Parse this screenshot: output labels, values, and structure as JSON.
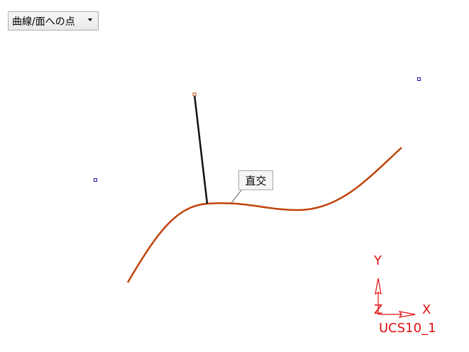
{
  "toolbar": {
    "mode_select": {
      "selected": "曲線/面への点"
    }
  },
  "annotation": {
    "constraint_label": "直交"
  },
  "ucs": {
    "x_label": "X",
    "y_label": "Y",
    "z_label": "Z",
    "name": "UCS10_1"
  },
  "colors": {
    "curve": "#c0440a",
    "line": "#111111",
    "control_point": "#1a1aa0",
    "endpoint_marker": "#c05010",
    "ucs": "#e01010"
  }
}
